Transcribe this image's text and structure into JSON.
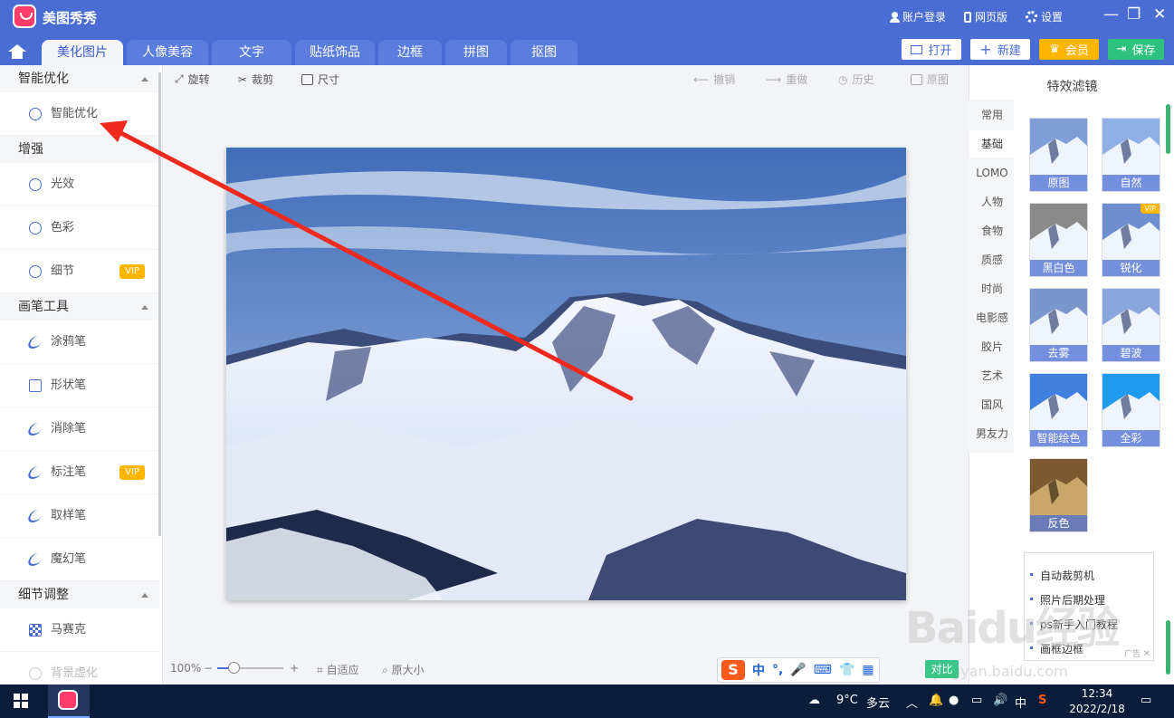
{
  "app": {
    "title": "美图秀秀"
  },
  "titlebar": {
    "links": [
      {
        "label": "账户登录",
        "icon": "user-icon"
      },
      {
        "label": "网页版",
        "icon": "phone-icon"
      },
      {
        "label": "设置",
        "icon": "gear-icon"
      }
    ],
    "controls": {
      "minimize": "—",
      "restore": "❐",
      "close": "✕"
    }
  },
  "tabs": [
    "美化图片",
    "人像美容",
    "文字",
    "贴纸饰品",
    "边框",
    "拼图",
    "抠图"
  ],
  "header_buttons": {
    "open": "打开",
    "new": "新建",
    "member": "会员",
    "save": "保存"
  },
  "left_panel": {
    "sections": [
      {
        "title": "智能优化",
        "items": [
          {
            "label": "智能优化",
            "vip": false
          }
        ]
      },
      {
        "title": "增强",
        "items": [
          {
            "label": "光效",
            "vip": false
          },
          {
            "label": "色彩",
            "vip": false
          },
          {
            "label": "细节",
            "vip": true
          }
        ]
      },
      {
        "title": "画笔工具",
        "items": [
          {
            "label": "涂鸦笔",
            "vip": false
          },
          {
            "label": "形状笔",
            "vip": false
          },
          {
            "label": "消除笔",
            "vip": false
          },
          {
            "label": "标注笔",
            "vip": true
          },
          {
            "label": "取样笔",
            "vip": false
          },
          {
            "label": "魔幻笔",
            "vip": false
          }
        ]
      },
      {
        "title": "细节调整",
        "items": [
          {
            "label": "马赛克",
            "vip": false
          },
          {
            "label": "背景虚化",
            "vip": false
          }
        ]
      }
    ],
    "vip_label": "VIP"
  },
  "toolbar": {
    "rotate": "旋转",
    "crop": "裁剪",
    "size": "尺寸",
    "undo": "撤销",
    "redo": "重做",
    "history": "历史",
    "original": "原图"
  },
  "zoom": {
    "level": "100%",
    "minus": "−",
    "plus": "+",
    "fit": "自适应",
    "actual": "原大小",
    "slider_value": 0.25
  },
  "right_panel": {
    "title": "特效滤镜",
    "categories": [
      "常用",
      "基础",
      "LOMO",
      "人物",
      "食物",
      "质感",
      "时尚",
      "电影感",
      "胶片",
      "艺术",
      "国风",
      "男友力"
    ],
    "active_category": "基础",
    "filters": [
      {
        "label": "原图",
        "vip": false
      },
      {
        "label": "自然",
        "vip": false
      },
      {
        "label": "黑白色",
        "vip": false
      },
      {
        "label": "锐化",
        "vip": true
      },
      {
        "label": "去雾",
        "vip": false
      },
      {
        "label": "碧波",
        "vip": false
      },
      {
        "label": "智能绘色",
        "vip": false
      },
      {
        "label": "全彩",
        "vip": false
      },
      {
        "label": "反色",
        "vip": false
      }
    ],
    "vip_label": "VIP"
  },
  "ad": {
    "items": [
      "自动裁剪机",
      "照片后期处理",
      "ps新手入门教程",
      "画框边框"
    ],
    "tag": "广告",
    "close": "✕"
  },
  "compare_button": "对比",
  "ime": {
    "logo": "S",
    "mode": "中",
    "punct": "°,"
  },
  "taskbar": {
    "weather_temp": "9°C",
    "weather_desc": "多云",
    "ime_lang": "中",
    "time": "12:34",
    "date": "2022/2/18"
  },
  "watermark": {
    "brand": "Baidu经验",
    "url": "jingyan.baidu.com"
  },
  "colors": {
    "brand_blue": "#4a6dd3",
    "vip_gold": "#ffb600",
    "save_green": "#2dc27d",
    "arrow_red": "#ee2a1e"
  }
}
